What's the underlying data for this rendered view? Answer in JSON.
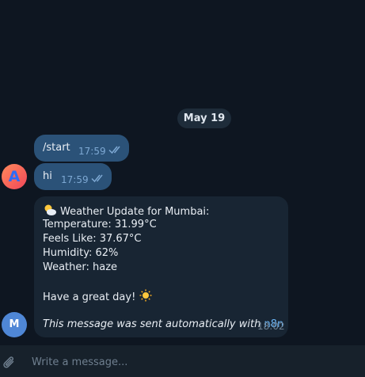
{
  "chat": {
    "date_label": "May 19",
    "outgoing": [
      {
        "text": "/start",
        "time": "17:59",
        "status_icon": "double-check-icon"
      },
      {
        "text": "hi",
        "time": "17:59",
        "status_icon": "double-check-icon"
      }
    ],
    "sender_avatar": {
      "letter": "A",
      "icon": "app-logo-a-icon"
    },
    "bot_avatar": {
      "letter": "M"
    },
    "incoming": {
      "lines": [
        "Weather Update for Mumbai:",
        "Temperature: 31.99°C",
        "Feels Like: 37.67°C",
        "Humidity: 62%",
        "Weather: haze"
      ],
      "greeting": "Have a great day!",
      "footer_text": "This message was sent automatically with",
      "footer_link": "n8n",
      "time": "18:02",
      "title_emoji": "sun-behind-cloud-icon",
      "greeting_emoji": "sun-icon"
    }
  },
  "composer": {
    "placeholder": "Write a message...",
    "value": "",
    "attach_icon": "paperclip-icon"
  },
  "colors": {
    "background": "#0e1621",
    "outgoing_bubble": "#2b5278",
    "incoming_bubble": "#182533",
    "link": "#6ab3f3",
    "composer": "#17212b"
  }
}
